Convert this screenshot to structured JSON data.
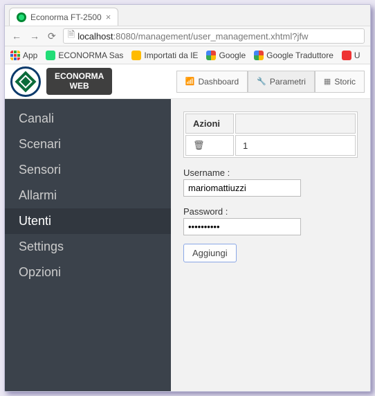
{
  "browser": {
    "tab_title": "Econorma FT-2500",
    "url_host": "localhost",
    "url_port": ":8080",
    "url_path": "/management/user_management.xhtml?jfw",
    "bookmarks": [
      "App",
      "ECONORMA Sas",
      "Importati da IE",
      "Google",
      "Google Traduttore",
      "U"
    ]
  },
  "header": {
    "brand_line1": "ECONORMA",
    "brand_line2": "WEB",
    "tabs": {
      "dashboard": "Dashboard",
      "parametri": "Parametri",
      "storico": "Storic"
    }
  },
  "sidebar": {
    "items": [
      "Canali",
      "Scenari",
      "Sensori",
      "Allarmi",
      "Utenti",
      "Settings",
      "Opzioni"
    ],
    "active_index": 4
  },
  "content": {
    "table": {
      "col_actions": "Azioni",
      "row1_id": "1"
    },
    "username_label": "Username :",
    "username_value": "mariomattiuzzi",
    "password_label": "Password :",
    "password_value": "••••••••••",
    "add_button": "Aggiungi"
  }
}
